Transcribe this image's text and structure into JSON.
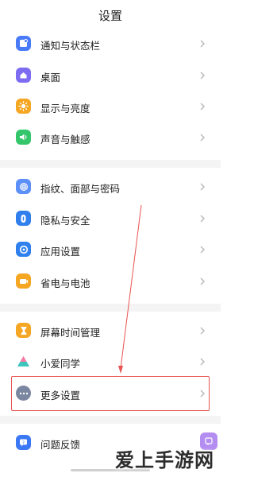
{
  "header": {
    "title": "设置"
  },
  "sections": [
    {
      "items": [
        {
          "id": "notifications",
          "label": "通知与状态栏",
          "icon": "notification-icon",
          "color": "#4a7bf7"
        },
        {
          "id": "desktop",
          "label": "桌面",
          "icon": "home-icon",
          "color": "#7c6cf2"
        },
        {
          "id": "display",
          "label": "显示与亮度",
          "icon": "sun-icon",
          "color": "#f5a623"
        },
        {
          "id": "sound",
          "label": "声音与触感",
          "icon": "speaker-icon",
          "color": "#35c66b"
        }
      ]
    },
    {
      "items": [
        {
          "id": "security",
          "label": "指纹、面部与密码",
          "icon": "fingerprint-icon",
          "color": "#5b8ff9"
        },
        {
          "id": "privacy",
          "label": "隐私与安全",
          "icon": "privacy-icon",
          "color": "#2f80ed"
        },
        {
          "id": "apps",
          "label": "应用设置",
          "icon": "app-settings-icon",
          "color": "#2f80ed"
        },
        {
          "id": "battery",
          "label": "省电与电池",
          "icon": "battery-icon",
          "color": "#f5a623"
        }
      ]
    },
    {
      "items": [
        {
          "id": "screen_time",
          "label": "屏幕时间管理",
          "icon": "hourglass-icon",
          "color": "#f5a623"
        },
        {
          "id": "xiaoai",
          "label": "小爱同学",
          "icon": "xiaoai-icon",
          "color": "#6a8dff"
        },
        {
          "id": "more",
          "label": "更多设置",
          "icon": "more-dots-icon",
          "color": "#7b86a0"
        }
      ]
    },
    {
      "items": [
        {
          "id": "feedback",
          "label": "问题反馈",
          "icon": "feedback-icon",
          "color": "#3b78f5"
        }
      ]
    }
  ],
  "annotation": {
    "highlight_color": "#e85450",
    "highlighted_item": "更多设置"
  },
  "watermark": {
    "text": "爱上手游网"
  }
}
